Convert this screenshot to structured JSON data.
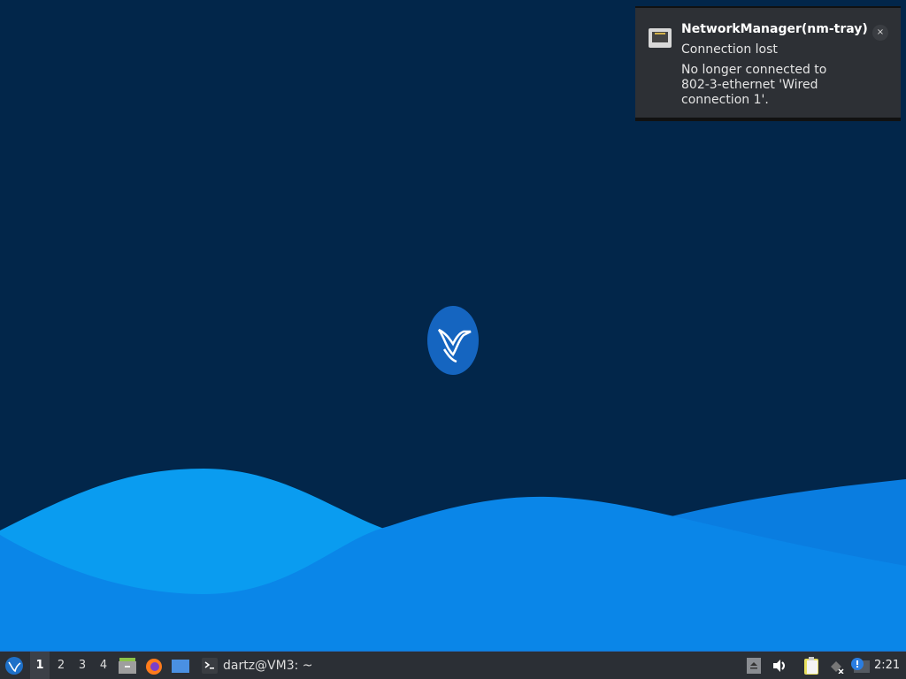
{
  "notification": {
    "app": "NetworkManager(nm-tray)",
    "summary": "Connection lost",
    "body": "No longer connected to 802-3-ethernet 'Wired connection 1'.",
    "close": "×",
    "icon": "ethernet-port-icon"
  },
  "taskbar": {
    "menu_icon": "hummingbird-menu-icon",
    "workspaces": [
      "1",
      "2",
      "3",
      "4"
    ],
    "active_workspace": "1",
    "launchers": [
      "file-manager-icon",
      "firefox-icon",
      "desktop-icon"
    ],
    "task": {
      "label": "dartz@VM3: ~",
      "icon": "terminal-icon"
    },
    "tray": [
      "eject-icon",
      "volume-icon",
      "clipboard-icon",
      "network-disconnected-icon",
      "notification-icon"
    ],
    "clock": "2:21"
  },
  "colors": {
    "background": "#02264a",
    "accent": "#1e70c8",
    "panel": "#2b2f35"
  }
}
